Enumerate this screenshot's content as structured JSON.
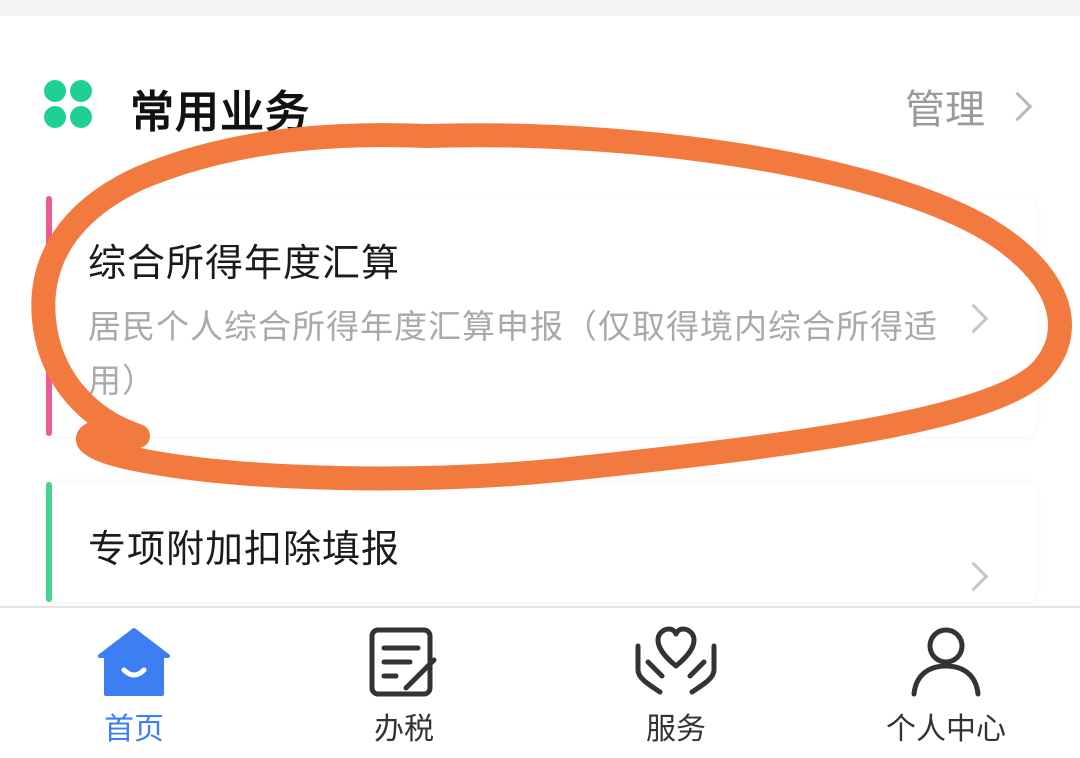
{
  "section": {
    "title": "常用业务",
    "manage_label": "管理"
  },
  "cards": [
    {
      "title": "综合所得年度汇算",
      "description": "居民个人综合所得年度汇算申报（仅取得境内综合所得适用）",
      "accent_color": "#ec5b95"
    },
    {
      "title": "专项附加扣除填报",
      "accent_color": "#46d28f"
    }
  ],
  "tabs": [
    {
      "label": "首页",
      "icon": "home-icon",
      "active": true
    },
    {
      "label": "办税",
      "icon": "tax-form-icon",
      "active": false
    },
    {
      "label": "服务",
      "icon": "service-heart-icon",
      "active": false
    },
    {
      "label": "个人中心",
      "icon": "user-icon",
      "active": false
    }
  ],
  "colors": {
    "brand_green": "#1ecf96",
    "active_blue": "#3d7ff2",
    "annotation_orange": "#f37a3e"
  }
}
